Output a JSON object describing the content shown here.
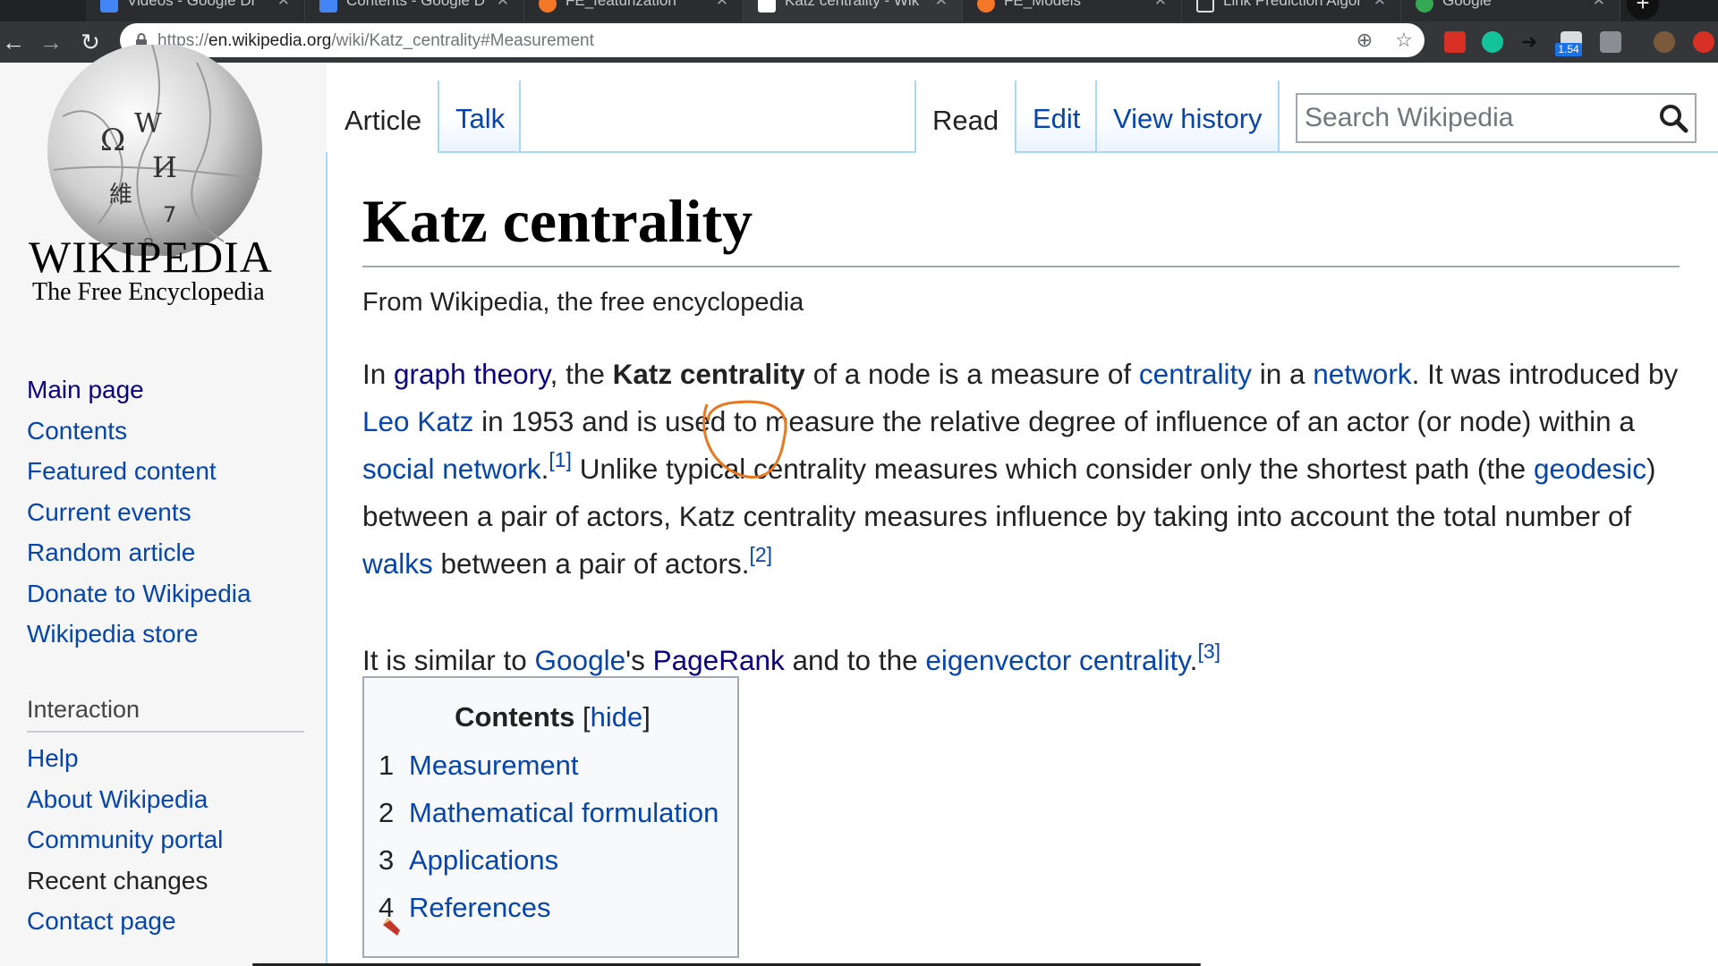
{
  "browser": {
    "tabs": [
      {
        "title": "Videos - Google Dr",
        "icon": "google-drive-icon",
        "color": "#4285f4"
      },
      {
        "title": "Contents - Google D",
        "icon": "google-docs-icon",
        "color": "#4285f4"
      },
      {
        "title": "FE_featurization",
        "icon": "jupyter-icon",
        "color": "#f37726"
      },
      {
        "title": "Katz centrality - Wik",
        "icon": "wikipedia-icon",
        "color": "#ffffff"
      },
      {
        "title": "FE_Models",
        "icon": "jupyter-icon",
        "color": "#f37726"
      },
      {
        "title": "Link Prediction Algor",
        "icon": "document-icon",
        "color": "#ffffff"
      },
      {
        "title": "Google",
        "icon": "google-icon",
        "color": "#34a853"
      }
    ],
    "url": {
      "scheme": "https://",
      "host": "en.wikipedia.org",
      "path": "/wiki/Katz_centrality#Measurement"
    },
    "extension_badge": "1.54"
  },
  "sidebar": {
    "logo": {
      "wordmark": "WIKIPEDIA",
      "tagline": "The Free Encyclopedia"
    },
    "navigation": [
      "Main page",
      "Contents",
      "Featured content",
      "Current events",
      "Random article",
      "Donate to Wikipedia",
      "Wikipedia store"
    ],
    "interaction": {
      "title": "Interaction",
      "items": [
        "Help",
        "About Wikipedia",
        "Community portal",
        "Recent changes",
        "Contact page"
      ]
    }
  },
  "tabs": {
    "article": "Article",
    "talk": "Talk",
    "read": "Read",
    "edit": "Edit",
    "history": "View history"
  },
  "search": {
    "placeholder": "Search Wikipedia"
  },
  "article": {
    "title": "Katz centrality",
    "subtitle": "From Wikipedia, the free encyclopedia",
    "p1": {
      "t1": "In ",
      "l_graph": "graph theory",
      "t2": ", the ",
      "bold": "Katz centrality",
      "t3": " of a node is a measure of ",
      "l_centrality": "centrality",
      "t4": " in a ",
      "l_network": "network",
      "t5": ". It was introduced by ",
      "l_katz": "Leo Katz",
      "t6": " in 1953 and is used to measure the relative degree of influence of an actor (or node) within a ",
      "l_social": "social network",
      "t7": ".",
      "ref1": "[1]",
      "t8": " Unlike typical centrality measures which consider only the shortest path (the ",
      "l_geodesic": "geodesic",
      "t9": ") between a pair of actors, Katz centrality measures influence by taking into account the total number of ",
      "l_walks": "walks",
      "t10": " between a pair of actors.",
      "ref2": "[2]"
    },
    "p2": {
      "t1": "It is similar to ",
      "l_google": "Google",
      "t2": "'s ",
      "l_pagerank": "PageRank",
      "t3": " and to the ",
      "l_eigen": "eigenvector centrality",
      "t4": ".",
      "ref3": "[3]"
    }
  },
  "toc": {
    "title": "Contents",
    "toggle": "hide",
    "items": [
      {
        "num": "1",
        "label": "Measurement"
      },
      {
        "num": "2",
        "label": "Mathematical formulation"
      },
      {
        "num": "3",
        "label": "Applications"
      },
      {
        "num": "4",
        "label": "References"
      }
    ]
  }
}
